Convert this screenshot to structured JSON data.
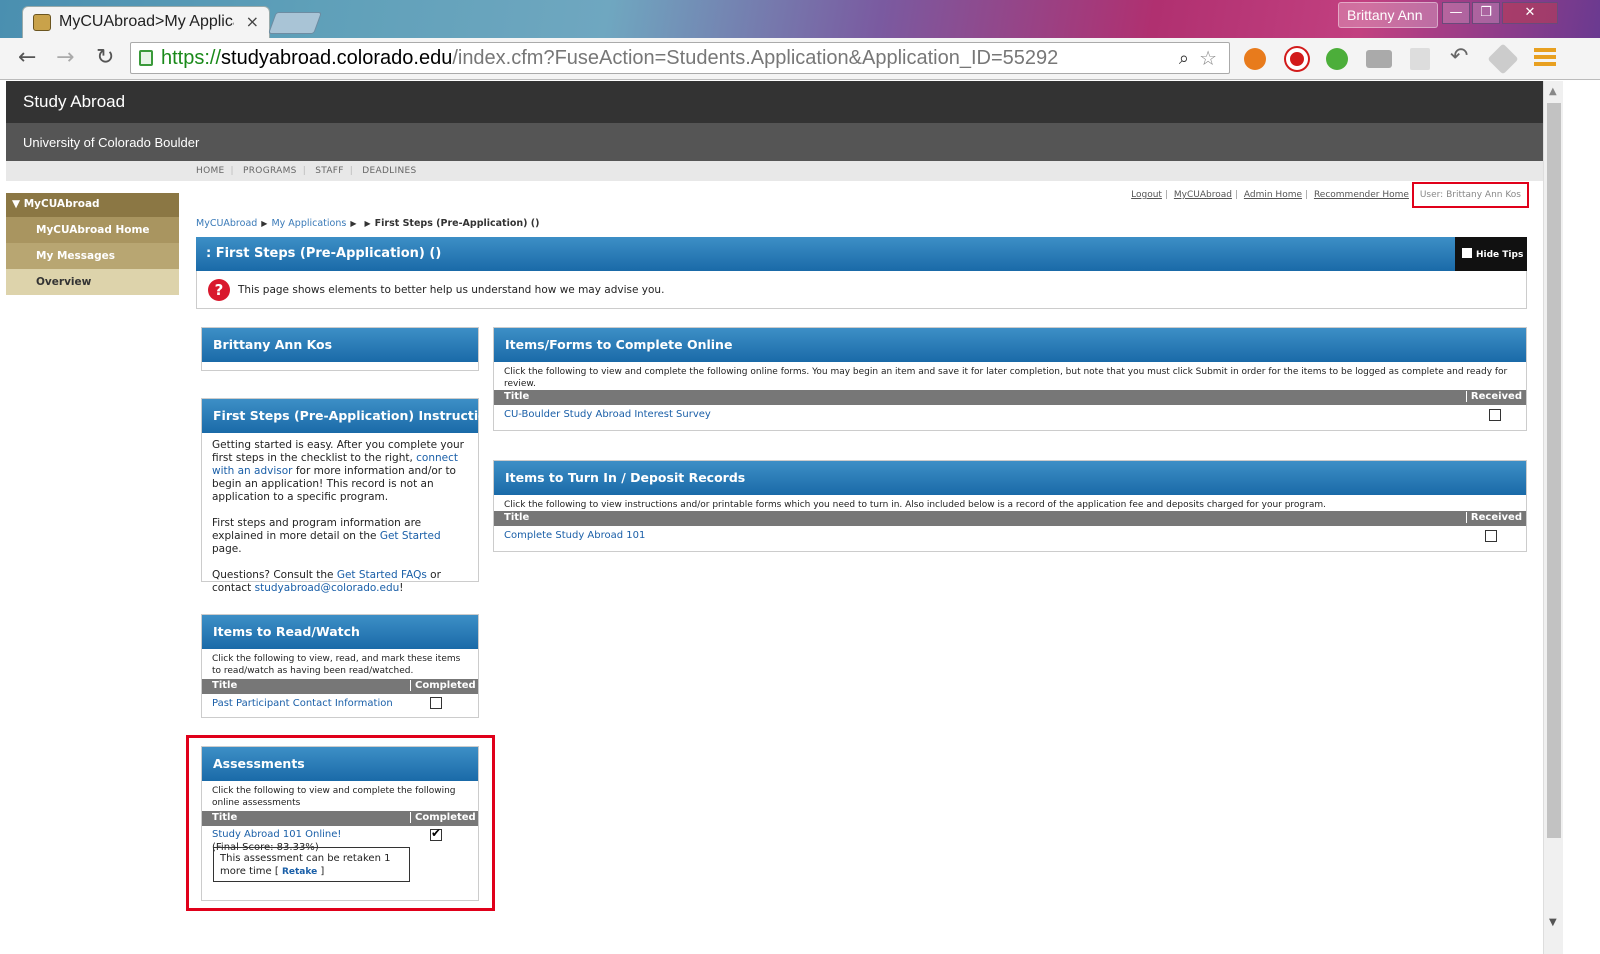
{
  "browser": {
    "tab_title": "MyCUAbroad>My Applica",
    "tab_close": "×",
    "profile_name": "Brittany Ann",
    "url_scheme": "https://",
    "url_host": "studyabroad.colorado.edu",
    "url_path": "/index.cfm?FuseAction=Students.Application&Application_ID=55292",
    "win_min": "—",
    "win_max": "❐",
    "win_close": "✕",
    "back": "←",
    "forward": "→",
    "reload": "↻"
  },
  "site": {
    "title": "Study Abroad",
    "subtitle": "University of Colorado Boulder",
    "nav": [
      "HOME",
      "PROGRAMS",
      "STAFF",
      "DEADLINES"
    ]
  },
  "userbar": {
    "links": [
      "Logout",
      "MyCUAbroad",
      "Admin Home",
      "Recommender Home"
    ],
    "user": "User: Brittany Ann Kos"
  },
  "sidebar": {
    "head": "MyCUAbroad",
    "items": [
      "MyCUAbroad Home",
      "My Messages",
      "Overview"
    ]
  },
  "breadcrumb": {
    "items": [
      "MyCUAbroad",
      "My Applications"
    ],
    "current": "First Steps (Pre-Application) ()"
  },
  "main": {
    "title": ": First Steps (Pre-Application) ()",
    "hide_tips": "Hide Tips",
    "tip_icon": "?",
    "tip": "This page shows elements to better help us understand how we may advise you."
  },
  "panels": {
    "name": {
      "title": "Brittany Ann Kos"
    },
    "instructions": {
      "title": "First Steps (Pre-Application) Instructions",
      "p1_a": "Getting started is easy. After you complete your first steps in the checklist to the right, ",
      "p1_link": "connect with an advisor",
      "p1_b": " for more information and/or to begin an application! This record is not an application to a specific program.",
      "p2_a": "First steps and program information are explained in more detail on the ",
      "p2_link": "Get Started",
      "p2_b": " page.",
      "p3_a": "Questions? Consult the ",
      "p3_link": "Get Started FAQs",
      "p3_b": " or contact ",
      "p3_email": "studyabroad@colorado.edu",
      "p3_c": "!"
    },
    "read": {
      "title": "Items to Read/Watch",
      "desc": "Click the following to view, read, and mark these items to read/watch as having been read/watched.",
      "col_title": "Title",
      "col_status": "Completed",
      "rows": [
        {
          "title": "Past Participant Contact Information",
          "completed": false
        }
      ]
    },
    "assessments": {
      "title": "Assessments",
      "desc": "Click the following to view and complete the following online assessments",
      "col_title": "Title",
      "col_status": "Completed",
      "row_title": "Study Abroad 101 Online!",
      "row_score": "(Final Score: 83.33%)",
      "completed": true,
      "retake_text": "This assessment can be retaken 1 more time [",
      "retake_link": "Retake",
      "retake_end": "]"
    },
    "online": {
      "title": "Items/Forms to Complete Online",
      "desc": "Click the following to view and complete the following online forms. You may begin an item and save it for later completion, but note that you must click Submit in order for the items to be logged as complete and ready for review.",
      "col_title": "Title",
      "col_status": "Received",
      "rows": [
        {
          "title": "CU-Boulder Study Abroad Interest Survey",
          "received": false
        }
      ]
    },
    "turnin": {
      "title": "Items to Turn In / Deposit Records",
      "desc": "Click the following to view instructions and/or printable forms which you need to turn in. Also included below is a record of the application fee and deposits charged for your program.",
      "col_title": "Title",
      "col_status": "Received",
      "rows": [
        {
          "title": "Complete Study Abroad 101",
          "received": false
        }
      ]
    }
  }
}
